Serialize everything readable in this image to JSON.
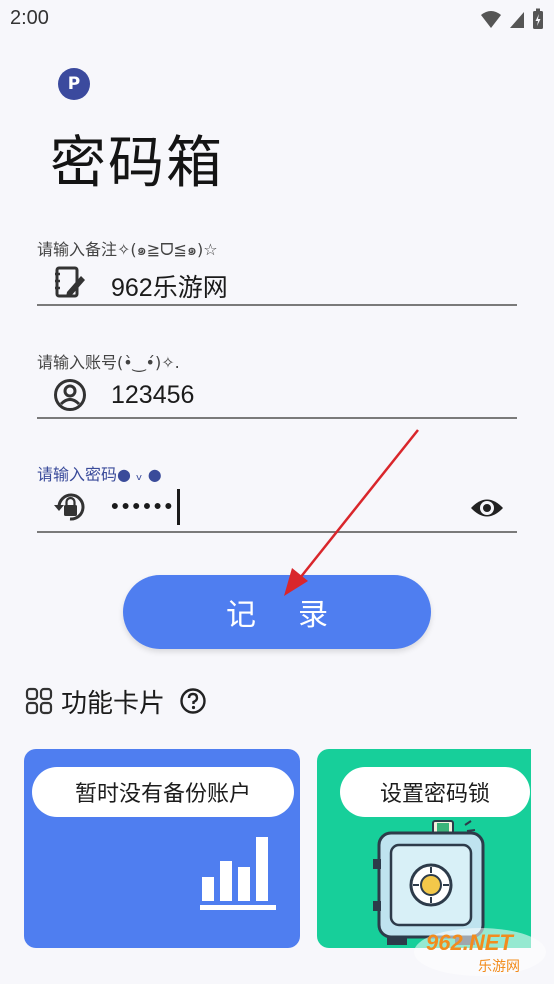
{
  "status_bar": {
    "time": "2:00"
  },
  "app": {
    "logo_letter": "P",
    "title": "密码箱"
  },
  "form": {
    "note": {
      "label": "请输入备注✧(๑≧ᗜ≦๑)☆",
      "value": "962乐游网"
    },
    "account": {
      "label": "请输入账号(•̀‿•́)✧.",
      "value": "123456"
    },
    "password": {
      "label": "请输入密码● ᵥ ●",
      "value": "••••••"
    }
  },
  "record_button": {
    "label": "记录"
  },
  "feature_section": {
    "title": "功能卡片"
  },
  "cards": [
    {
      "label": "暂时没有备份账户",
      "color": "#4f7ef0"
    },
    {
      "label": "设置密码锁",
      "color": "#17cf9a"
    }
  ],
  "watermark": {
    "text": "962.NET",
    "subtext": "乐游网"
  },
  "colors": {
    "primary": "#4f7ef0",
    "accent_green": "#17cf9a",
    "logo": "#3b4a9e",
    "arrow": "#d9262b"
  }
}
